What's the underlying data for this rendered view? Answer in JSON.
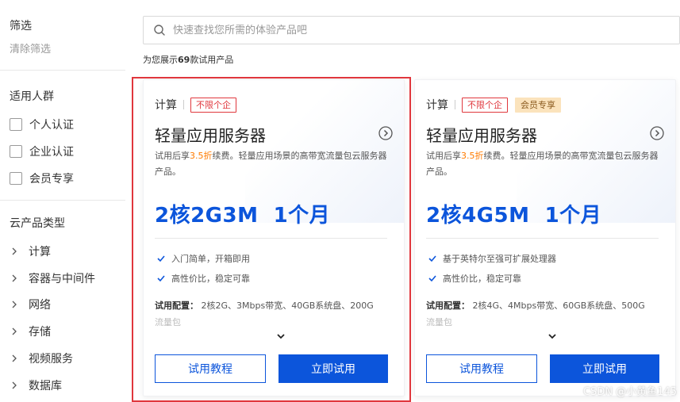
{
  "sidebar": {
    "filter_title": "筛选",
    "clear_filter": "清除筛选",
    "audience_title": "适用人群",
    "audience_options": [
      {
        "label": "个人认证",
        "checked": false
      },
      {
        "label": "企业认证",
        "checked": false
      },
      {
        "label": "会员专享",
        "checked": false
      }
    ],
    "category_title": "云产品类型",
    "categories": [
      {
        "label": "计算"
      },
      {
        "label": "容器与中间件"
      },
      {
        "label": "网络"
      },
      {
        "label": "存储"
      },
      {
        "label": "视频服务"
      },
      {
        "label": "数据库"
      }
    ]
  },
  "search": {
    "placeholder": "快速查找您所需的体验产品吧",
    "value": ""
  },
  "results": {
    "prefix": "为您展示",
    "count": "69",
    "suffix": "款试用产品"
  },
  "cards": [
    {
      "category": "计算",
      "tag_red": "不限个企",
      "tag_gold": "",
      "title": "轻量应用服务器",
      "desc_before": "试用后享",
      "desc_highlight": "3.5折",
      "desc_after": "续费。轻量应用场景的高带宽流量包云服务器产品。",
      "spec": "2核2G3M  1个月",
      "features": [
        "入门简单，开箱即用",
        "高性价比，稳定可靠"
      ],
      "config_label": "试用配置：",
      "config_text": "2核2G、3Mbps带宽、40GB系统盘、200G",
      "config_fade": "流量包",
      "btn_tutorial": "试用教程",
      "btn_try": "立即试用"
    },
    {
      "category": "计算",
      "tag_red": "不限个企",
      "tag_gold": "会员专享",
      "title": "轻量应用服务器",
      "desc_before": "试用后享",
      "desc_highlight": "3.5折",
      "desc_after": "续费。轻量应用场景的高带宽流量包云服务器产品。",
      "spec": "2核4G5M  1个月",
      "features": [
        "基于英特尔至强可扩展处理器",
        "高性价比，稳定可靠"
      ],
      "config_label": "试用配置：",
      "config_text": "2核4G、4Mbps带宽、60GB系统盘、500G",
      "config_fade": "流量包",
      "btn_tutorial": "试用教程",
      "btn_try": "立即试用"
    }
  ],
  "watermark": "CSDN @小黄鱼145",
  "colors": {
    "primary": "#0c55db",
    "highlight_red": "#e0373d",
    "discount_orange": "#ff7b00",
    "gold_tag_bg": "#fbe3bc"
  }
}
